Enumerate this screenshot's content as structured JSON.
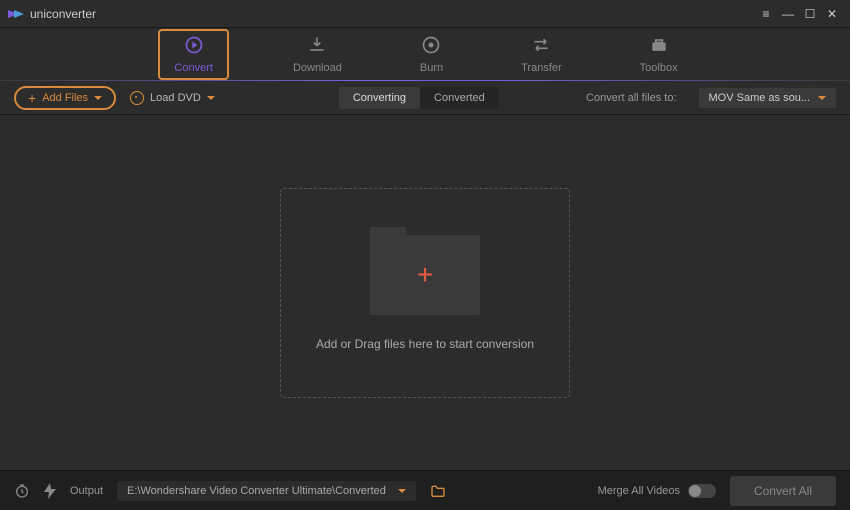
{
  "app": {
    "name": "uniconverter"
  },
  "navtabs": {
    "convert": "Convert",
    "download": "Download",
    "burn": "Burn",
    "transfer": "Transfer",
    "toolbox": "Toolbox"
  },
  "subtool": {
    "add_files": "Add Files",
    "load_dvd": "Load DVD",
    "tab_converting": "Converting",
    "tab_converted": "Converted",
    "convert_all_label": "Convert all files to:",
    "format_selected": "MOV Same as sou..."
  },
  "dropzone": {
    "text": "Add or Drag files here to start conversion"
  },
  "bottombar": {
    "output_label": "Output",
    "output_path": "E:\\Wondershare Video Converter Ultimate\\Converted",
    "merge_label": "Merge All Videos",
    "convert_all_btn": "Convert All"
  },
  "colors": {
    "accent_orange": "#d98b3d",
    "accent_purple": "#7b5bda",
    "accent_red": "#e85c3f"
  }
}
